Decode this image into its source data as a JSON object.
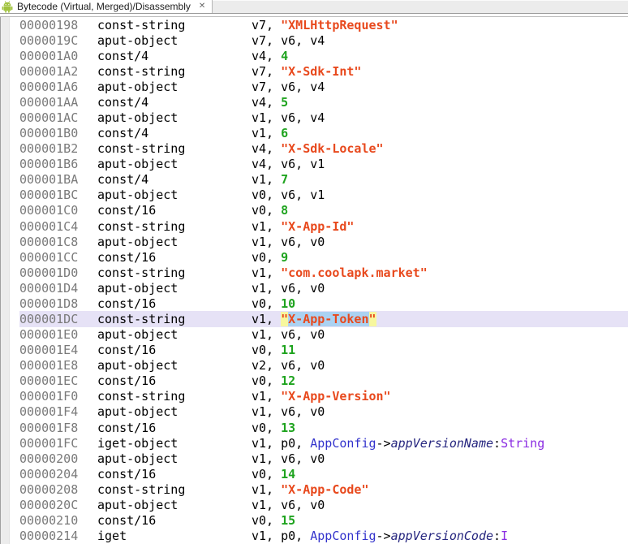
{
  "tab": {
    "title": "Bytecode (Virtual, Merged)/Disassembly",
    "close_glyph": "✕"
  },
  "colors": {
    "address": "#7a7a7a",
    "mnemonic": "#000000",
    "string": "#e8491d",
    "number": "#1ea31e",
    "class_ref": "#3333cc",
    "field_ref": "#26267f",
    "type_ref": "#8a2be2",
    "current_line_bg": "#e6e2f6",
    "search_highlight_bg": "#f7f79e",
    "selection_bg": "#abd2f2",
    "android_green": "#a0c23d"
  },
  "disassembly": {
    "rows": [
      {
        "address": "00000198",
        "mnemonic": "const-string",
        "operands": [
          {
            "text": "v7, "
          },
          {
            "text": "\"XMLHttpRequest\"",
            "kind": "string"
          }
        ]
      },
      {
        "address": "0000019C",
        "mnemonic": "aput-object",
        "operands": [
          {
            "text": "v7, v6, v4"
          }
        ]
      },
      {
        "address": "000001A0",
        "mnemonic": "const/4",
        "operands": [
          {
            "text": "v4, "
          },
          {
            "text": "4",
            "kind": "number"
          }
        ]
      },
      {
        "address": "000001A2",
        "mnemonic": "const-string",
        "operands": [
          {
            "text": "v7, "
          },
          {
            "text": "\"X-Sdk-Int\"",
            "kind": "string"
          }
        ]
      },
      {
        "address": "000001A6",
        "mnemonic": "aput-object",
        "operands": [
          {
            "text": "v7, v6, v4"
          }
        ]
      },
      {
        "address": "000001AA",
        "mnemonic": "const/4",
        "operands": [
          {
            "text": "v4, "
          },
          {
            "text": "5",
            "kind": "number"
          }
        ]
      },
      {
        "address": "000001AC",
        "mnemonic": "aput-object",
        "operands": [
          {
            "text": "v1, v6, v4"
          }
        ]
      },
      {
        "address": "000001B0",
        "mnemonic": "const/4",
        "operands": [
          {
            "text": "v1, "
          },
          {
            "text": "6",
            "kind": "number"
          }
        ]
      },
      {
        "address": "000001B2",
        "mnemonic": "const-string",
        "operands": [
          {
            "text": "v4, "
          },
          {
            "text": "\"X-Sdk-Locale\"",
            "kind": "string"
          }
        ]
      },
      {
        "address": "000001B6",
        "mnemonic": "aput-object",
        "operands": [
          {
            "text": "v4, v6, v1"
          }
        ]
      },
      {
        "address": "000001BA",
        "mnemonic": "const/4",
        "operands": [
          {
            "text": "v1, "
          },
          {
            "text": "7",
            "kind": "number"
          }
        ]
      },
      {
        "address": "000001BC",
        "mnemonic": "aput-object",
        "operands": [
          {
            "text": "v0, v6, v1"
          }
        ]
      },
      {
        "address": "000001C0",
        "mnemonic": "const/16",
        "operands": [
          {
            "text": "v0, "
          },
          {
            "text": "8",
            "kind": "number"
          }
        ]
      },
      {
        "address": "000001C4",
        "mnemonic": "const-string",
        "operands": [
          {
            "text": "v1, "
          },
          {
            "text": "\"X-App-Id\"",
            "kind": "string"
          }
        ]
      },
      {
        "address": "000001C8",
        "mnemonic": "aput-object",
        "operands": [
          {
            "text": "v1, v6, v0"
          }
        ]
      },
      {
        "address": "000001CC",
        "mnemonic": "const/16",
        "operands": [
          {
            "text": "v0, "
          },
          {
            "text": "9",
            "kind": "number"
          }
        ]
      },
      {
        "address": "000001D0",
        "mnemonic": "const-string",
        "operands": [
          {
            "text": "v1, "
          },
          {
            "text": "\"com.coolapk.market\"",
            "kind": "string"
          }
        ]
      },
      {
        "address": "000001D4",
        "mnemonic": "aput-object",
        "operands": [
          {
            "text": "v1, v6, v0"
          }
        ]
      },
      {
        "address": "000001D8",
        "mnemonic": "const/16",
        "operands": [
          {
            "text": "v0, "
          },
          {
            "text": "10",
            "kind": "number"
          }
        ]
      },
      {
        "address": "000001DC",
        "mnemonic": "const-string",
        "current": true,
        "operands": [
          {
            "text": "v1, "
          },
          {
            "text": "\"",
            "kind": "string",
            "hl": "search"
          },
          {
            "text": "X-App-Token",
            "kind": "string",
            "hl": "selection"
          },
          {
            "text": "\"",
            "kind": "string",
            "hl": "search"
          }
        ]
      },
      {
        "address": "000001E0",
        "mnemonic": "aput-object",
        "operands": [
          {
            "text": "v1, v6, v0"
          }
        ]
      },
      {
        "address": "000001E4",
        "mnemonic": "const/16",
        "operands": [
          {
            "text": "v0, "
          },
          {
            "text": "11",
            "kind": "number"
          }
        ]
      },
      {
        "address": "000001E8",
        "mnemonic": "aput-object",
        "operands": [
          {
            "text": "v2, v6, v0"
          }
        ]
      },
      {
        "address": "000001EC",
        "mnemonic": "const/16",
        "operands": [
          {
            "text": "v0, "
          },
          {
            "text": "12",
            "kind": "number"
          }
        ]
      },
      {
        "address": "000001F0",
        "mnemonic": "const-string",
        "operands": [
          {
            "text": "v1, "
          },
          {
            "text": "\"X-App-Version\"",
            "kind": "string"
          }
        ]
      },
      {
        "address": "000001F4",
        "mnemonic": "aput-object",
        "operands": [
          {
            "text": "v1, v6, v0"
          }
        ]
      },
      {
        "address": "000001F8",
        "mnemonic": "const/16",
        "operands": [
          {
            "text": "v0, "
          },
          {
            "text": "13",
            "kind": "number"
          }
        ]
      },
      {
        "address": "000001FC",
        "mnemonic": "iget-object",
        "operands": [
          {
            "text": "v1, p0, "
          },
          {
            "text": "AppConfig",
            "kind": "class"
          },
          {
            "text": "->"
          },
          {
            "text": "appVersionName",
            "kind": "field"
          },
          {
            "text": ":"
          },
          {
            "text": "String",
            "kind": "type"
          }
        ]
      },
      {
        "address": "00000200",
        "mnemonic": "aput-object",
        "operands": [
          {
            "text": "v1, v6, v0"
          }
        ]
      },
      {
        "address": "00000204",
        "mnemonic": "const/16",
        "operands": [
          {
            "text": "v0, "
          },
          {
            "text": "14",
            "kind": "number"
          }
        ]
      },
      {
        "address": "00000208",
        "mnemonic": "const-string",
        "operands": [
          {
            "text": "v1, "
          },
          {
            "text": "\"X-App-Code\"",
            "kind": "string"
          }
        ]
      },
      {
        "address": "0000020C",
        "mnemonic": "aput-object",
        "operands": [
          {
            "text": "v1, v6, v0"
          }
        ]
      },
      {
        "address": "00000210",
        "mnemonic": "const/16",
        "operands": [
          {
            "text": "v0, "
          },
          {
            "text": "15",
            "kind": "number"
          }
        ]
      },
      {
        "address": "00000214",
        "mnemonic": "iget",
        "operands": [
          {
            "text": "v1, p0, "
          },
          {
            "text": "AppConfig",
            "kind": "class"
          },
          {
            "text": "->"
          },
          {
            "text": "appVersionCode",
            "kind": "field"
          },
          {
            "text": ":"
          },
          {
            "text": "I",
            "kind": "type"
          }
        ]
      }
    ]
  }
}
